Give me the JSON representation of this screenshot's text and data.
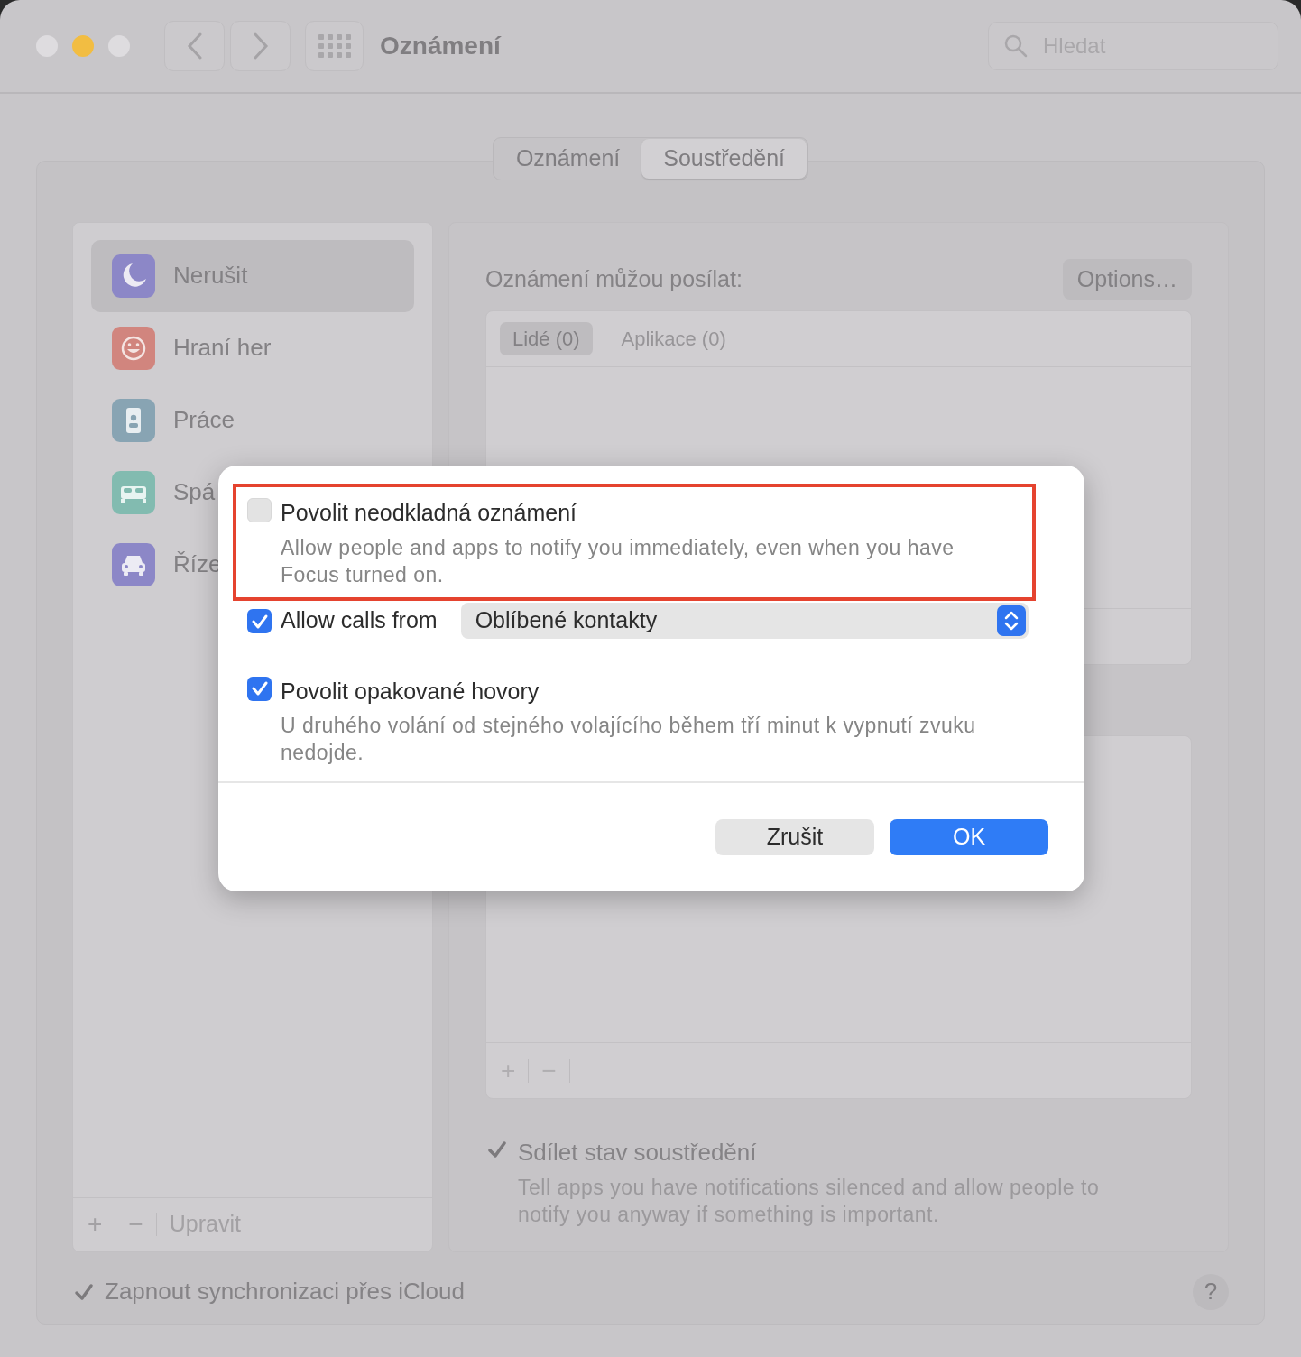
{
  "window": {
    "title": "Oznámení",
    "search": {
      "placeholder": "Hledat"
    }
  },
  "tabs": [
    {
      "label": "Oznámení",
      "selected": false
    },
    {
      "label": "Soustředění",
      "selected": true
    }
  ],
  "sidebar": {
    "items": [
      {
        "label": "Nerušit",
        "kind": "moon",
        "color": "#8c87c7",
        "selected": true
      },
      {
        "label": "Hraní her",
        "kind": "smiley",
        "color": "#d1857e",
        "selected": false
      },
      {
        "label": "Práce",
        "kind": "badge",
        "color": "#88a4b3",
        "selected": false
      },
      {
        "label": "Spá",
        "kind": "bed",
        "color": "#82bbb0",
        "selected": false
      },
      {
        "label": "Říze",
        "kind": "car",
        "color": "#8c87c7",
        "selected": false
      }
    ],
    "footer": {
      "add": "+",
      "remove": "−",
      "edit": "Upravit"
    }
  },
  "allowed": {
    "label": "Oznámení můžou posílat:",
    "options_button": "Options…",
    "tabs": [
      {
        "label": "Lidé (0)",
        "selected": true
      },
      {
        "label": "Aplikace (0)",
        "selected": false
      }
    ]
  },
  "second_list": {
    "add": "+",
    "remove": "−"
  },
  "share_focus": {
    "label": "Sdílet stav soustředění",
    "description": "Tell apps you have notifications silenced and allow people to notify you anyway if something is important.",
    "checked": true
  },
  "icloud_sync": {
    "label": "Zapnout synchronizaci přes iCloud",
    "checked": true
  },
  "help": "?",
  "dialog": {
    "options": [
      {
        "kind": "checkbox",
        "label": "Povolit neodkladná oznámení",
        "description": "Allow people and apps to notify you immediately, even when you have Focus turned on.",
        "checked": false,
        "highlighted": true
      },
      {
        "kind": "select",
        "label": "Allow calls from",
        "value": "Oblíbené kontakty",
        "checked": true,
        "highlighted": false
      },
      {
        "kind": "checkbox",
        "label": "Povolit opakované hovory",
        "description": "U druhého volání od stejného volajícího během tří minut k vypnutí zvuku nedojde.",
        "checked": true,
        "highlighted": false
      }
    ],
    "buttons": [
      {
        "label": "Zrušit",
        "kind": "secondary"
      },
      {
        "label": "OK",
        "kind": "primary"
      }
    ]
  }
}
